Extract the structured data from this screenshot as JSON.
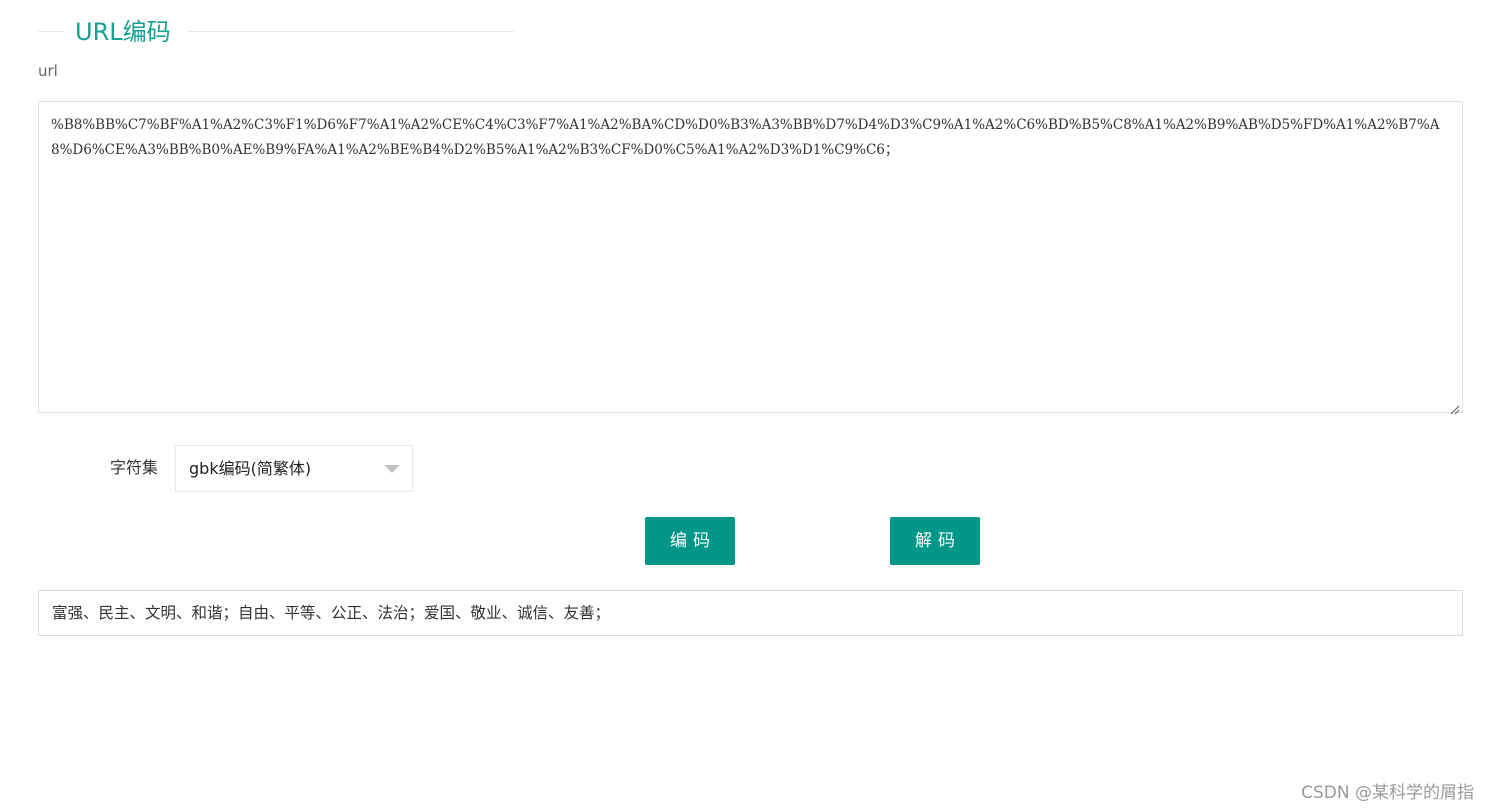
{
  "section": {
    "title": "URL编码"
  },
  "form": {
    "url_label": "url",
    "url_value": "%B8%BB%C7%BF%A1%A2%C3%F1%D6%F7%A1%A2%CE%C4%C3%F7%A1%A2%BA%CD%D0%B3%A3%BB%D7%D4%D3%C9%A1%A2%C6%BD%B5%C8%A1%A2%B9%AB%D5%FD%A1%A2%B7%A8%D6%CE%A3%BB%B0%AE%B9%FA%A1%A2%BE%B4%D2%B5%A1%A2%B3%CF%D0%C5%A1%A2%D3%D1%C9%C6；",
    "charset_label": "字符集",
    "charset_selected": "gbk编码(简繁体)",
    "encode_button": "编码",
    "decode_button": "解码",
    "result_value": "富强、民主、文明、和谐；自由、平等、公正、法治；爱国、敬业、诚信、友善；"
  },
  "watermark": {
    "text": "CSDN @某科学的屑指"
  },
  "colors": {
    "accent": "#009688",
    "title": "#16a190"
  },
  "icons": {
    "select_caret": "caret-down-icon",
    "textarea_resize": "resize-grip-icon"
  }
}
